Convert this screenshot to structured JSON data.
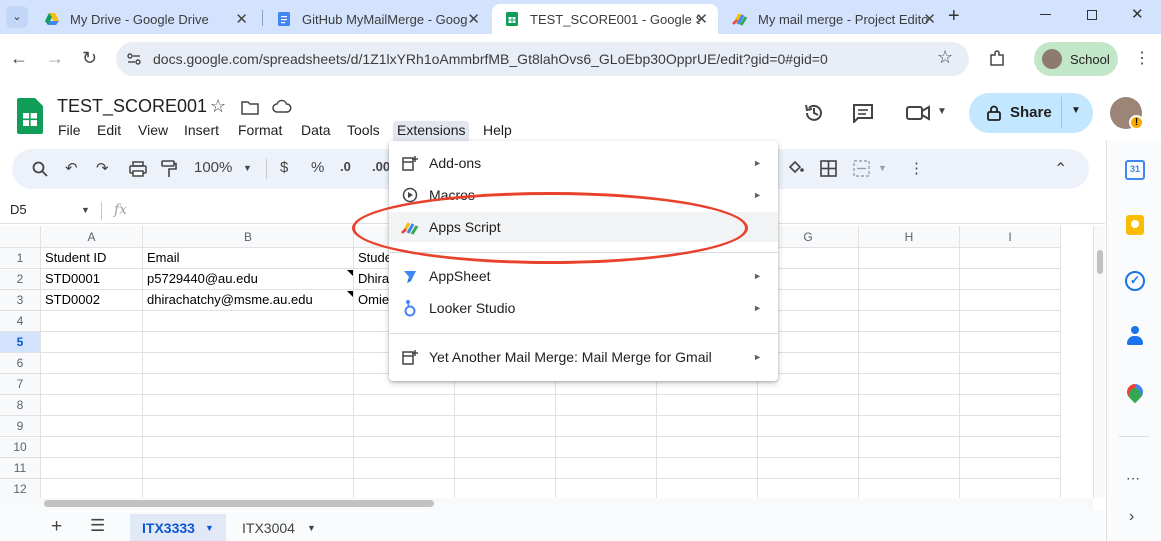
{
  "browser": {
    "tabs": [
      {
        "title": "My Drive - Google Drive",
        "icon": "google-drive-icon"
      },
      {
        "title": "GitHub MyMailMerge - Goog",
        "icon": "google-docs-icon"
      },
      {
        "title": "TEST_SCORE001 - Google She",
        "icon": "google-sheets-icon"
      },
      {
        "title": "My mail merge - Project Edito",
        "icon": "apps-script-icon"
      }
    ],
    "new_tab": "+",
    "url": "docs.google.com/spreadsheets/d/1Z1lxYRh1oAmmbrfMB_Gt8lahOvs6_GLoEbp30OpprUE/edit?gid=0#gid=0",
    "profile_label": "School"
  },
  "sheets": {
    "doc_title": "TEST_SCORE001",
    "menus": [
      "File",
      "Edit",
      "View",
      "Insert",
      "Format",
      "Data",
      "Tools",
      "Extensions",
      "Help"
    ],
    "share_label": "Share",
    "toolbar": {
      "zoom": "100%",
      "currency": "$",
      "percent": "%",
      "decimal_dec": ".0",
      "decimal_inc": ".00"
    },
    "name_box": "D5",
    "fx": "fx",
    "columns": [
      "A",
      "B",
      "C",
      "D",
      "E",
      "F",
      "G",
      "H",
      "I"
    ],
    "rows": [
      "1",
      "2",
      "3",
      "4",
      "5",
      "6",
      "7",
      "8",
      "9",
      "10",
      "11",
      "12"
    ],
    "cells": {
      "A1": "Student ID",
      "B1": "Email",
      "C1": "Stude",
      "A2": "STD0001",
      "B2": "p5729440@au.edu",
      "C2": "Dhira",
      "A3": "STD0002",
      "B3": "dhirachatchy@msme.au.edu",
      "C3": "Omie"
    },
    "sheet_tabs": [
      "ITX3333",
      "ITX3004"
    ]
  },
  "extensions_menu": {
    "items": [
      {
        "label": "Add-ons",
        "icon": "add-ons-icon",
        "submenu": true
      },
      {
        "label": "Macros",
        "icon": "macros-icon",
        "submenu": true
      },
      {
        "label": "Apps Script",
        "icon": "apps-script-icon",
        "submenu": false
      },
      {
        "label": "AppSheet",
        "icon": "appsheet-icon",
        "submenu": true
      },
      {
        "label": "Looker Studio",
        "icon": "looker-studio-icon",
        "submenu": true
      },
      {
        "label": "Yet Another Mail Merge: Mail Merge for Gmail",
        "icon": "yamm-icon",
        "submenu": true
      }
    ]
  },
  "colors": {
    "accent": "#0b57d0",
    "annotation": "#e8412c",
    "sheets_green": "#0f9d58"
  }
}
